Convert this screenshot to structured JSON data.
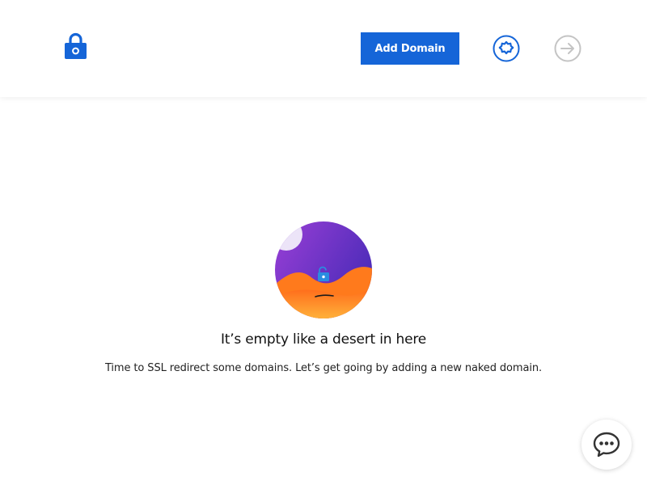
{
  "header": {
    "logo_icon": "lock-icon",
    "add_domain_label": "Add Domain",
    "settings_icon": "gear-icon",
    "logout_icon": "arrow-right-circle-icon"
  },
  "empty_state": {
    "illustration": "desert-lock-illustration",
    "title": "It’s empty like a desert in here",
    "subtitle": "Time to SSL redirect some domains. Let’s get going by adding a new naked domain."
  },
  "chat": {
    "icon": "chat-bubble-icon"
  },
  "colors": {
    "accent": "#1565d8",
    "muted_icon": "#c4c4c4",
    "illustration_sky": "#6d35c9",
    "illustration_sand": "#ff8a1c"
  }
}
